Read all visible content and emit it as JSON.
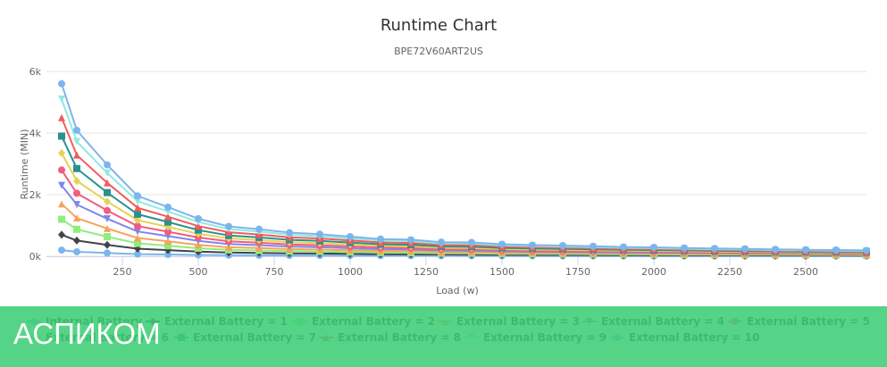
{
  "chart_data": {
    "type": "line",
    "title": "Runtime Chart",
    "subtitle": "BPE72V60ART2US",
    "xlabel": "Load (w)",
    "ylabel": "Runtime (MIN)",
    "xlim": [
      0,
      2700
    ],
    "ylim": [
      0,
      6000
    ],
    "x_ticks": [
      "250",
      "500",
      "750",
      "1000",
      "1250",
      "1500",
      "1750",
      "2000",
      "2250",
      "2500"
    ],
    "y_ticks": [
      "0k",
      "2k",
      "4k",
      "6k"
    ],
    "grid": true,
    "legend_placement": "bottom",
    "x": [
      50,
      100,
      200,
      300,
      400,
      500,
      600,
      700,
      800,
      900,
      1000,
      1100,
      1200,
      1300,
      1400,
      1500,
      1600,
      1700,
      1800,
      1900,
      2000,
      2100,
      2200,
      2300,
      2400,
      2500,
      2600,
      2700
    ],
    "series": [
      {
        "name": "Internal Battery",
        "color": "#7cb5ec",
        "marker": "circle",
        "values": [
          200,
          146,
          106,
          70,
          57,
          44,
          35,
          31,
          27,
          26,
          23,
          20,
          19,
          16,
          16,
          14,
          13,
          12,
          12,
          11,
          10,
          10,
          9,
          9,
          8,
          8,
          7,
          7
        ]
      },
      {
        "name": "External Battery = 1",
        "color": "#434348",
        "marker": "diamond",
        "values": [
          700,
          511,
          371,
          245,
          200,
          153,
          121,
          110,
          96,
          90,
          80,
          70,
          67,
          57,
          56,
          49,
          46,
          43,
          41,
          38,
          36,
          34,
          32,
          30,
          28,
          27,
          25,
          24
        ]
      },
      {
        "name": "External Battery = 2",
        "color": "#90ed7d",
        "marker": "square",
        "values": [
          1200,
          876,
          636,
          420,
          342,
          262,
          208,
          188,
          164,
          154,
          137,
          120,
          115,
          98,
          96,
          84,
          78,
          74,
          70,
          65,
          62,
          58,
          54,
          52,
          48,
          46,
          43,
          41
        ]
      },
      {
        "name": "External Battery = 3",
        "color": "#f7a35c",
        "marker": "triangle",
        "values": [
          1700,
          1241,
          901,
          595,
          485,
          371,
          294,
          267,
          233,
          218,
          194,
          170,
          163,
          139,
          136,
          119,
          111,
          105,
          99,
          92,
          88,
          82,
          77,
          73,
          68,
          65,
          61,
          58
        ]
      },
      {
        "name": "External Battery = 4",
        "color": "#8085e9",
        "marker": "triangle-down",
        "values": [
          2300,
          1679,
          1219,
          805,
          656,
          501,
          398,
          361,
          315,
          294,
          262,
          230,
          221,
          189,
          184,
          161,
          150,
          143,
          133,
          124,
          120,
          110,
          104,
          99,
          92,
          87,
          83,
          78
        ]
      },
      {
        "name": "External Battery = 5",
        "color": "#f15c80",
        "marker": "circle",
        "values": [
          2800,
          2044,
          1484,
          980,
          798,
          610,
          484,
          440,
          384,
          358,
          319,
          280,
          269,
          230,
          224,
          196,
          182,
          174,
          162,
          151,
          146,
          134,
          126,
          120,
          112,
          106,
          101,
          95
        ]
      },
      {
        "name": "External Battery = 6",
        "color": "#e4d354",
        "marker": "diamond",
        "values": [
          3350,
          2446,
          1776,
          1173,
          955,
          730,
          580,
          526,
          459,
          429,
          382,
          335,
          322,
          275,
          268,
          235,
          218,
          208,
          194,
          181,
          174,
          161,
          151,
          144,
          134,
          127,
          121,
          114
        ]
      },
      {
        "name": "External Battery = 7",
        "color": "#2b908f",
        "marker": "square",
        "values": [
          3900,
          2847,
          2067,
          1365,
          1112,
          850,
          675,
          612,
          534,
          499,
          445,
          390,
          374,
          320,
          312,
          273,
          254,
          242,
          226,
          211,
          203,
          187,
          176,
          168,
          156,
          148,
          140,
          133
        ]
      },
      {
        "name": "External Battery = 8",
        "color": "#f45b5b",
        "marker": "triangle",
        "values": [
          4500,
          3285,
          2385,
          1575,
          1283,
          981,
          779,
          707,
          617,
          576,
          513,
          450,
          432,
          369,
          360,
          315,
          293,
          279,
          261,
          243,
          234,
          216,
          203,
          194,
          180,
          171,
          162,
          153
        ]
      },
      {
        "name": "External Battery = 9",
        "color": "#91e8e1",
        "marker": "triangle-down",
        "values": [
          5100,
          3723,
          2703,
          1785,
          1454,
          1112,
          882,
          801,
          699,
          653,
          581,
          510,
          490,
          418,
          408,
          357,
          332,
          316,
          296,
          275,
          265,
          245,
          230,
          219,
          204,
          194,
          184,
          173
        ]
      },
      {
        "name": "External Battery = 10",
        "color": "#7cb5ec",
        "marker": "circle",
        "values": [
          5600,
          4088,
          2968,
          1960,
          1596,
          1221,
          969,
          879,
          767,
          717,
          638,
          560,
          538,
          459,
          448,
          392,
          364,
          347,
          325,
          302,
          291,
          269,
          252,
          241,
          224,
          213,
          202,
          190
        ]
      }
    ]
  },
  "watermark": "АСПИКОМ"
}
